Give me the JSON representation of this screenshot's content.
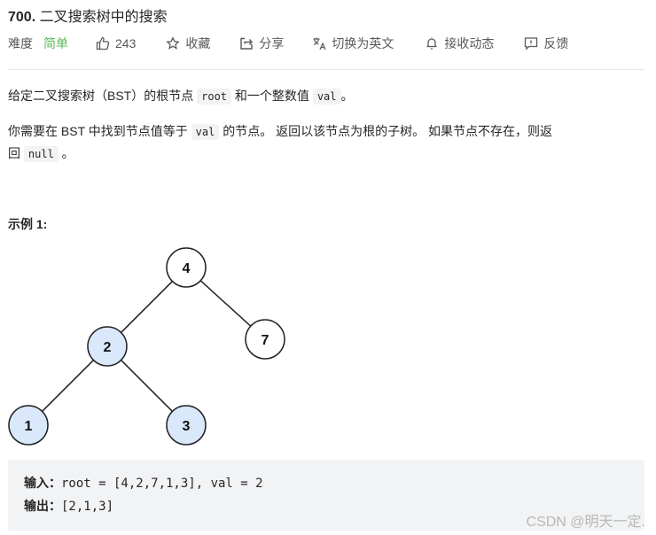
{
  "problem": {
    "number": "700.",
    "title": "二叉搜索树中的搜索"
  },
  "meta": {
    "difficulty_label": "难度",
    "difficulty_value": "简单",
    "likes": "243",
    "favorite_label": "收藏",
    "share_label": "分享",
    "translate_label": "切换为英文",
    "subscribe_label": "接收动态",
    "feedback_label": "反馈",
    "difficulty_color": "#5cb85c"
  },
  "description": {
    "p1": {
      "text_a": "给定二叉搜索树（BST）的根节点 ",
      "code_a": "root",
      "text_b": " 和一个整数值 ",
      "code_b": "val",
      "text_c": "。"
    },
    "p2": {
      "text_a": "你需要在 BST 中找到节点值等于 ",
      "code_a": "val",
      "text_b": " 的节点。 返回以该节点为根的子树。 如果节点不存在，则返",
      "text_c": "回 ",
      "code_b": "null",
      "text_d": " 。"
    }
  },
  "example": {
    "title": "示例 1:",
    "tree": {
      "nodes": [
        {
          "id": "n4",
          "label": "4",
          "highlighted": false
        },
        {
          "id": "n2",
          "label": "2",
          "highlighted": true
        },
        {
          "id": "n7",
          "label": "7",
          "highlighted": false
        },
        {
          "id": "n1",
          "label": "1",
          "highlighted": true
        },
        {
          "id": "n3",
          "label": "3",
          "highlighted": true
        }
      ],
      "edges": [
        [
          "n4",
          "n2"
        ],
        [
          "n4",
          "n7"
        ],
        [
          "n2",
          "n1"
        ],
        [
          "n2",
          "n3"
        ]
      ],
      "highlight_color": "#dae8fc"
    },
    "input_label": "输入：",
    "input_value": "root = [4,2,7,1,3], val = 2",
    "output_label": "输出：",
    "output_value": "[2,1,3]"
  },
  "watermark": "CSDN @明天一定."
}
